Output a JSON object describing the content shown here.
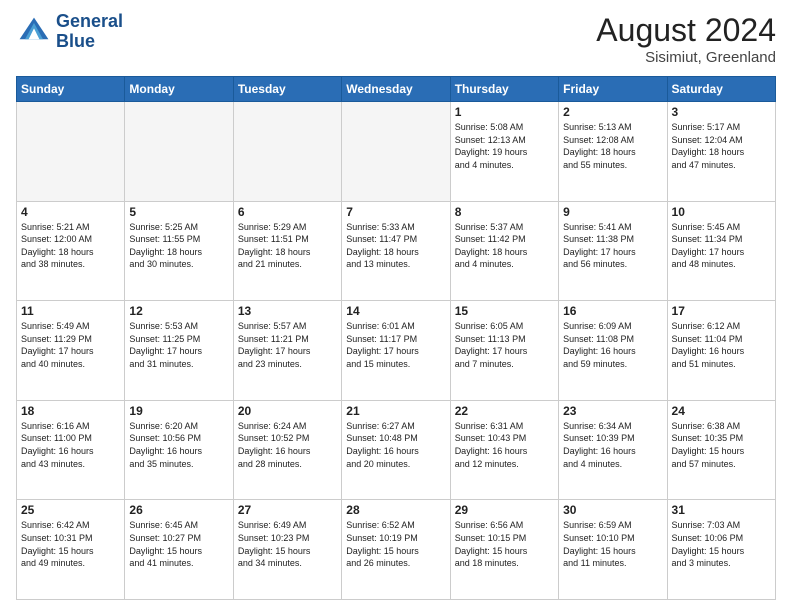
{
  "header": {
    "logo_line1": "General",
    "logo_line2": "Blue",
    "month_year": "August 2024",
    "location": "Sisimiut, Greenland"
  },
  "columns": [
    "Sunday",
    "Monday",
    "Tuesday",
    "Wednesday",
    "Thursday",
    "Friday",
    "Saturday"
  ],
  "weeks": [
    [
      {
        "day": "",
        "info": ""
      },
      {
        "day": "",
        "info": ""
      },
      {
        "day": "",
        "info": ""
      },
      {
        "day": "",
        "info": ""
      },
      {
        "day": "1",
        "info": "Sunrise: 5:08 AM\nSunset: 12:13 AM\nDaylight: 19 hours\nand 4 minutes."
      },
      {
        "day": "2",
        "info": "Sunrise: 5:13 AM\nSunset: 12:08 AM\nDaylight: 18 hours\nand 55 minutes."
      },
      {
        "day": "3",
        "info": "Sunrise: 5:17 AM\nSunset: 12:04 AM\nDaylight: 18 hours\nand 47 minutes."
      }
    ],
    [
      {
        "day": "4",
        "info": "Sunrise: 5:21 AM\nSunset: 12:00 AM\nDaylight: 18 hours\nand 38 minutes."
      },
      {
        "day": "5",
        "info": "Sunrise: 5:25 AM\nSunset: 11:55 PM\nDaylight: 18 hours\nand 30 minutes."
      },
      {
        "day": "6",
        "info": "Sunrise: 5:29 AM\nSunset: 11:51 PM\nDaylight: 18 hours\nand 21 minutes."
      },
      {
        "day": "7",
        "info": "Sunrise: 5:33 AM\nSunset: 11:47 PM\nDaylight: 18 hours\nand 13 minutes."
      },
      {
        "day": "8",
        "info": "Sunrise: 5:37 AM\nSunset: 11:42 PM\nDaylight: 18 hours\nand 4 minutes."
      },
      {
        "day": "9",
        "info": "Sunrise: 5:41 AM\nSunset: 11:38 PM\nDaylight: 17 hours\nand 56 minutes."
      },
      {
        "day": "10",
        "info": "Sunrise: 5:45 AM\nSunset: 11:34 PM\nDaylight: 17 hours\nand 48 minutes."
      }
    ],
    [
      {
        "day": "11",
        "info": "Sunrise: 5:49 AM\nSunset: 11:29 PM\nDaylight: 17 hours\nand 40 minutes."
      },
      {
        "day": "12",
        "info": "Sunrise: 5:53 AM\nSunset: 11:25 PM\nDaylight: 17 hours\nand 31 minutes."
      },
      {
        "day": "13",
        "info": "Sunrise: 5:57 AM\nSunset: 11:21 PM\nDaylight: 17 hours\nand 23 minutes."
      },
      {
        "day": "14",
        "info": "Sunrise: 6:01 AM\nSunset: 11:17 PM\nDaylight: 17 hours\nand 15 minutes."
      },
      {
        "day": "15",
        "info": "Sunrise: 6:05 AM\nSunset: 11:13 PM\nDaylight: 17 hours\nand 7 minutes."
      },
      {
        "day": "16",
        "info": "Sunrise: 6:09 AM\nSunset: 11:08 PM\nDaylight: 16 hours\nand 59 minutes."
      },
      {
        "day": "17",
        "info": "Sunrise: 6:12 AM\nSunset: 11:04 PM\nDaylight: 16 hours\nand 51 minutes."
      }
    ],
    [
      {
        "day": "18",
        "info": "Sunrise: 6:16 AM\nSunset: 11:00 PM\nDaylight: 16 hours\nand 43 minutes."
      },
      {
        "day": "19",
        "info": "Sunrise: 6:20 AM\nSunset: 10:56 PM\nDaylight: 16 hours\nand 35 minutes."
      },
      {
        "day": "20",
        "info": "Sunrise: 6:24 AM\nSunset: 10:52 PM\nDaylight: 16 hours\nand 28 minutes."
      },
      {
        "day": "21",
        "info": "Sunrise: 6:27 AM\nSunset: 10:48 PM\nDaylight: 16 hours\nand 20 minutes."
      },
      {
        "day": "22",
        "info": "Sunrise: 6:31 AM\nSunset: 10:43 PM\nDaylight: 16 hours\nand 12 minutes."
      },
      {
        "day": "23",
        "info": "Sunrise: 6:34 AM\nSunset: 10:39 PM\nDaylight: 16 hours\nand 4 minutes."
      },
      {
        "day": "24",
        "info": "Sunrise: 6:38 AM\nSunset: 10:35 PM\nDaylight: 15 hours\nand 57 minutes."
      }
    ],
    [
      {
        "day": "25",
        "info": "Sunrise: 6:42 AM\nSunset: 10:31 PM\nDaylight: 15 hours\nand 49 minutes."
      },
      {
        "day": "26",
        "info": "Sunrise: 6:45 AM\nSunset: 10:27 PM\nDaylight: 15 hours\nand 41 minutes."
      },
      {
        "day": "27",
        "info": "Sunrise: 6:49 AM\nSunset: 10:23 PM\nDaylight: 15 hours\nand 34 minutes."
      },
      {
        "day": "28",
        "info": "Sunrise: 6:52 AM\nSunset: 10:19 PM\nDaylight: 15 hours\nand 26 minutes."
      },
      {
        "day": "29",
        "info": "Sunrise: 6:56 AM\nSunset: 10:15 PM\nDaylight: 15 hours\nand 18 minutes."
      },
      {
        "day": "30",
        "info": "Sunrise: 6:59 AM\nSunset: 10:10 PM\nDaylight: 15 hours\nand 11 minutes."
      },
      {
        "day": "31",
        "info": "Sunrise: 7:03 AM\nSunset: 10:06 PM\nDaylight: 15 hours\nand 3 minutes."
      }
    ]
  ]
}
